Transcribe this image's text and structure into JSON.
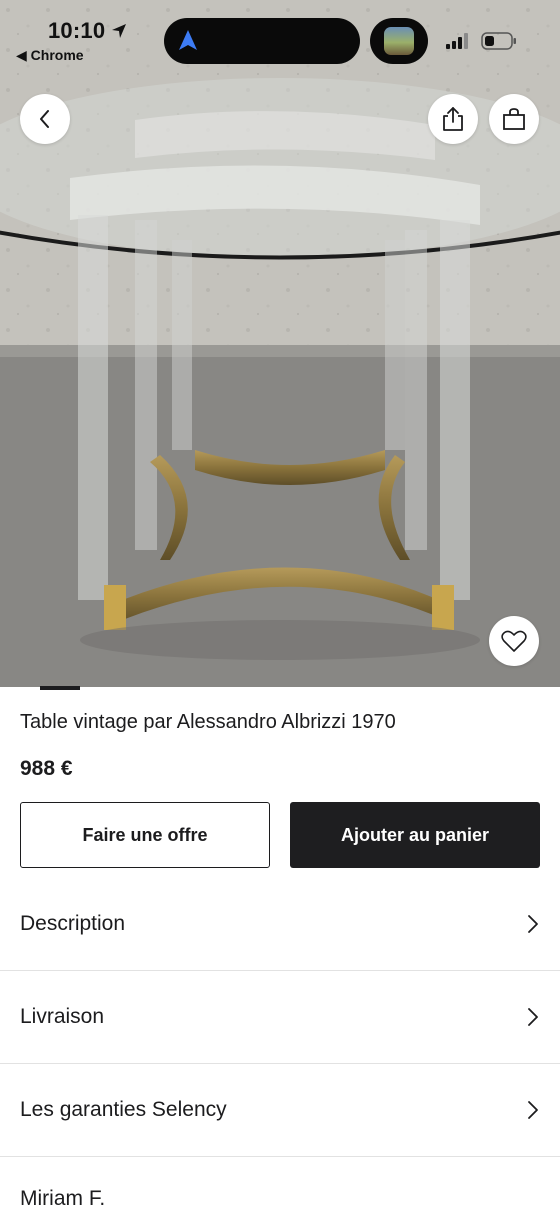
{
  "status_bar": {
    "time": "10:10",
    "back_app": "◀ Chrome"
  },
  "hero": {
    "icons": [
      "back-chevron-icon",
      "share-icon",
      "shopping-bag-icon",
      "heart-icon"
    ]
  },
  "product": {
    "title": "Table vintage par Alessandro Albrizzi 1970",
    "price": "988 €"
  },
  "actions": {
    "offer_label": "Faire une offre",
    "cart_label": "Ajouter au panier"
  },
  "sections": [
    {
      "label": "Description"
    },
    {
      "label": "Livraison"
    },
    {
      "label": "Les garanties Selency"
    }
  ],
  "seller": {
    "name": "Miriam F."
  },
  "colors": {
    "primary": "#1e1e20",
    "divider": "#e2e2e2",
    "background": "#ffffff"
  }
}
